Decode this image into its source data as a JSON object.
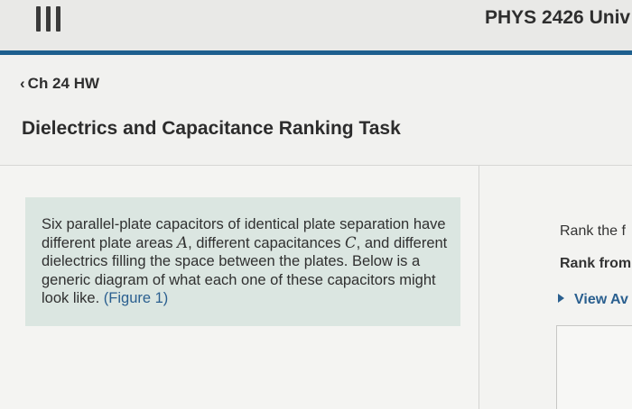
{
  "header": {
    "course_title": "PHYS 2426 Univ"
  },
  "nav": {
    "back_label": "Ch 24 HW"
  },
  "task": {
    "title": "Dielectrics and Capacitance Ranking Task"
  },
  "intro": {
    "text_1": "Six parallel-plate capacitors of identical plate separation have different plate areas ",
    "var_a": "A",
    "text_2": ", different capacitances ",
    "var_c": "C",
    "text_3": ", and different dielectrics filling the space between the plates. Below is a generic diagram of what each one of these capacitors might look like. ",
    "figure_link": "(Figure 1)"
  },
  "right_panel": {
    "rank_prompt": "Rank the f",
    "rank_from": "Rank from",
    "view_link": "View Av"
  },
  "colors": {
    "accent_blue": "#1d5f8e",
    "link_blue": "#2a5f8f",
    "intro_bg": "#dbe6e1"
  }
}
